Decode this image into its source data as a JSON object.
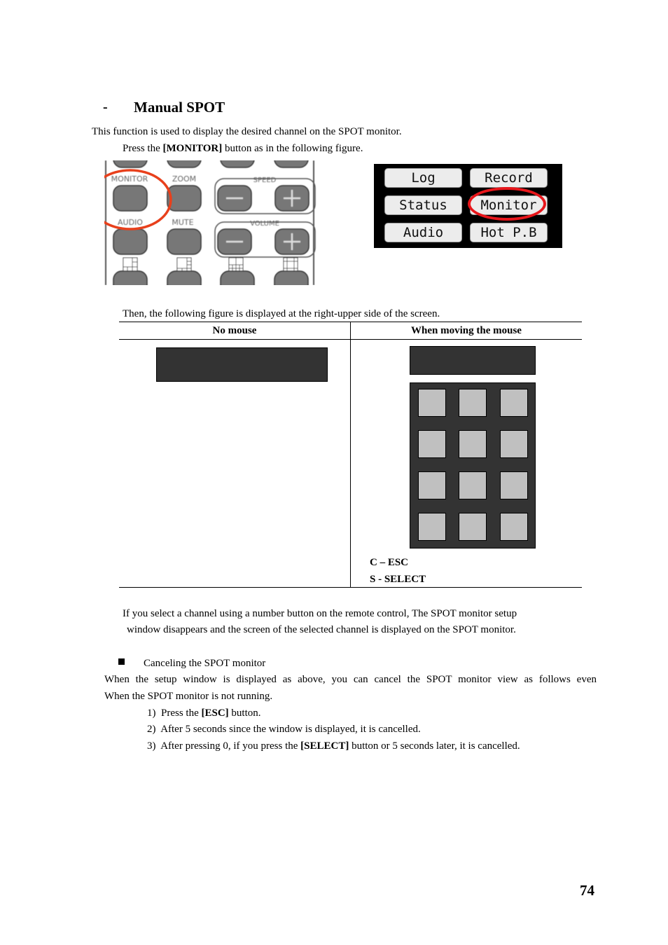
{
  "heading": {
    "dash": "-",
    "title": "Manual SPOT"
  },
  "intro": "This function is used to display the desired channel on the SPOT monitor.",
  "press_line": {
    "before": "Press the ",
    "key": "[MONITOR]",
    "after": " button as in the following figure."
  },
  "remote_figure": {
    "labels": [
      "MONITOR",
      "ZOOM",
      "SPEED",
      "AUDIO",
      "MUTE",
      "VOLUME"
    ],
    "minus": "—",
    "plus": "+",
    "highlighted": "MONITOR",
    "highlight_color": "#e8401c"
  },
  "osd_menu": {
    "buttons": [
      "Log",
      "Record",
      "Status",
      "Monitor",
      "Audio",
      "Hot P.B"
    ],
    "highlighted": "Monitor",
    "highlight_color": "#e8161b"
  },
  "then_line": "Then, the following figure is displayed at the right-upper side of the screen.",
  "table": {
    "headers": [
      "No mouse",
      "When moving the mouse"
    ],
    "keypad": {
      "rows": 4,
      "cols": 3
    },
    "legend": [
      "C – ESC",
      "S - SELECT"
    ],
    "box_color": "#333333",
    "key_color": "#c0c0c0"
  },
  "select_note": [
    "If you select a channel using a number button on the remote control, The SPOT monitor setup",
    "window disappears and the screen of the selected channel is displayed on the SPOT monitor."
  ],
  "cancel": {
    "bullet_title": "Canceling the SPOT monitor",
    "desc_1": "When the setup window is displayed as above, you can cancel the SPOT monitor view as follows even",
    "desc_2": "When the SPOT monitor is not running.",
    "steps": [
      {
        "num": "1)",
        "before": "Press the ",
        "key": "[ESC]",
        "after": " button."
      },
      {
        "num": "2)",
        "before": "After 5 seconds since the window is displayed, it is cancelled.",
        "key": "",
        "after": ""
      },
      {
        "num": "3)",
        "before": "After pressing 0, if you press the ",
        "key": "[SELECT]",
        "after": " button or 5 seconds later, it is cancelled."
      }
    ]
  },
  "page_number": "74"
}
